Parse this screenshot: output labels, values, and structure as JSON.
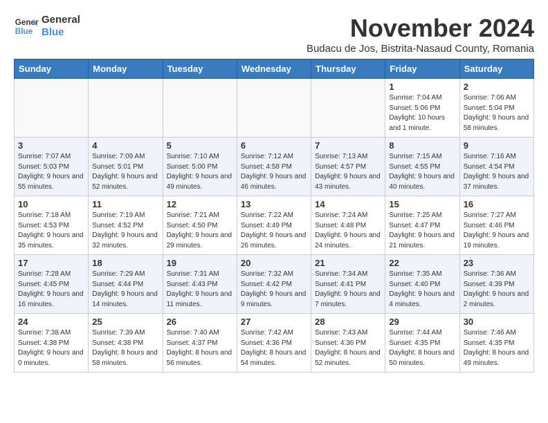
{
  "logo": {
    "line1": "General",
    "line2": "Blue"
  },
  "title": "November 2024",
  "subtitle": "Budacu de Jos, Bistrita-Nasaud County, Romania",
  "days_of_week": [
    "Sunday",
    "Monday",
    "Tuesday",
    "Wednesday",
    "Thursday",
    "Friday",
    "Saturday"
  ],
  "weeks": [
    [
      {
        "day": "",
        "info": ""
      },
      {
        "day": "",
        "info": ""
      },
      {
        "day": "",
        "info": ""
      },
      {
        "day": "",
        "info": ""
      },
      {
        "day": "",
        "info": ""
      },
      {
        "day": "1",
        "info": "Sunrise: 7:04 AM\nSunset: 5:06 PM\nDaylight: 10 hours and 1 minute."
      },
      {
        "day": "2",
        "info": "Sunrise: 7:06 AM\nSunset: 5:04 PM\nDaylight: 9 hours and 58 minutes."
      }
    ],
    [
      {
        "day": "3",
        "info": "Sunrise: 7:07 AM\nSunset: 5:03 PM\nDaylight: 9 hours and 55 minutes."
      },
      {
        "day": "4",
        "info": "Sunrise: 7:09 AM\nSunset: 5:01 PM\nDaylight: 9 hours and 52 minutes."
      },
      {
        "day": "5",
        "info": "Sunrise: 7:10 AM\nSunset: 5:00 PM\nDaylight: 9 hours and 49 minutes."
      },
      {
        "day": "6",
        "info": "Sunrise: 7:12 AM\nSunset: 4:58 PM\nDaylight: 9 hours and 46 minutes."
      },
      {
        "day": "7",
        "info": "Sunrise: 7:13 AM\nSunset: 4:57 PM\nDaylight: 9 hours and 43 minutes."
      },
      {
        "day": "8",
        "info": "Sunrise: 7:15 AM\nSunset: 4:55 PM\nDaylight: 9 hours and 40 minutes."
      },
      {
        "day": "9",
        "info": "Sunrise: 7:16 AM\nSunset: 4:54 PM\nDaylight: 9 hours and 37 minutes."
      }
    ],
    [
      {
        "day": "10",
        "info": "Sunrise: 7:18 AM\nSunset: 4:53 PM\nDaylight: 9 hours and 35 minutes."
      },
      {
        "day": "11",
        "info": "Sunrise: 7:19 AM\nSunset: 4:52 PM\nDaylight: 9 hours and 32 minutes."
      },
      {
        "day": "12",
        "info": "Sunrise: 7:21 AM\nSunset: 4:50 PM\nDaylight: 9 hours and 29 minutes."
      },
      {
        "day": "13",
        "info": "Sunrise: 7:22 AM\nSunset: 4:49 PM\nDaylight: 9 hours and 26 minutes."
      },
      {
        "day": "14",
        "info": "Sunrise: 7:24 AM\nSunset: 4:48 PM\nDaylight: 9 hours and 24 minutes."
      },
      {
        "day": "15",
        "info": "Sunrise: 7:25 AM\nSunset: 4:47 PM\nDaylight: 9 hours and 21 minutes."
      },
      {
        "day": "16",
        "info": "Sunrise: 7:27 AM\nSunset: 4:46 PM\nDaylight: 9 hours and 19 minutes."
      }
    ],
    [
      {
        "day": "17",
        "info": "Sunrise: 7:28 AM\nSunset: 4:45 PM\nDaylight: 9 hours and 16 minutes."
      },
      {
        "day": "18",
        "info": "Sunrise: 7:29 AM\nSunset: 4:44 PM\nDaylight: 9 hours and 14 minutes."
      },
      {
        "day": "19",
        "info": "Sunrise: 7:31 AM\nSunset: 4:43 PM\nDaylight: 9 hours and 11 minutes."
      },
      {
        "day": "20",
        "info": "Sunrise: 7:32 AM\nSunset: 4:42 PM\nDaylight: 9 hours and 9 minutes."
      },
      {
        "day": "21",
        "info": "Sunrise: 7:34 AM\nSunset: 4:41 PM\nDaylight: 9 hours and 7 minutes."
      },
      {
        "day": "22",
        "info": "Sunrise: 7:35 AM\nSunset: 4:40 PM\nDaylight: 9 hours and 4 minutes."
      },
      {
        "day": "23",
        "info": "Sunrise: 7:36 AM\nSunset: 4:39 PM\nDaylight: 9 hours and 2 minutes."
      }
    ],
    [
      {
        "day": "24",
        "info": "Sunrise: 7:38 AM\nSunset: 4:38 PM\nDaylight: 9 hours and 0 minutes."
      },
      {
        "day": "25",
        "info": "Sunrise: 7:39 AM\nSunset: 4:38 PM\nDaylight: 8 hours and 58 minutes."
      },
      {
        "day": "26",
        "info": "Sunrise: 7:40 AM\nSunset: 4:37 PM\nDaylight: 8 hours and 56 minutes."
      },
      {
        "day": "27",
        "info": "Sunrise: 7:42 AM\nSunset: 4:36 PM\nDaylight: 8 hours and 54 minutes."
      },
      {
        "day": "28",
        "info": "Sunrise: 7:43 AM\nSunset: 4:36 PM\nDaylight: 8 hours and 52 minutes."
      },
      {
        "day": "29",
        "info": "Sunrise: 7:44 AM\nSunset: 4:35 PM\nDaylight: 8 hours and 50 minutes."
      },
      {
        "day": "30",
        "info": "Sunrise: 7:46 AM\nSunset: 4:35 PM\nDaylight: 8 hours and 49 minutes."
      }
    ]
  ]
}
